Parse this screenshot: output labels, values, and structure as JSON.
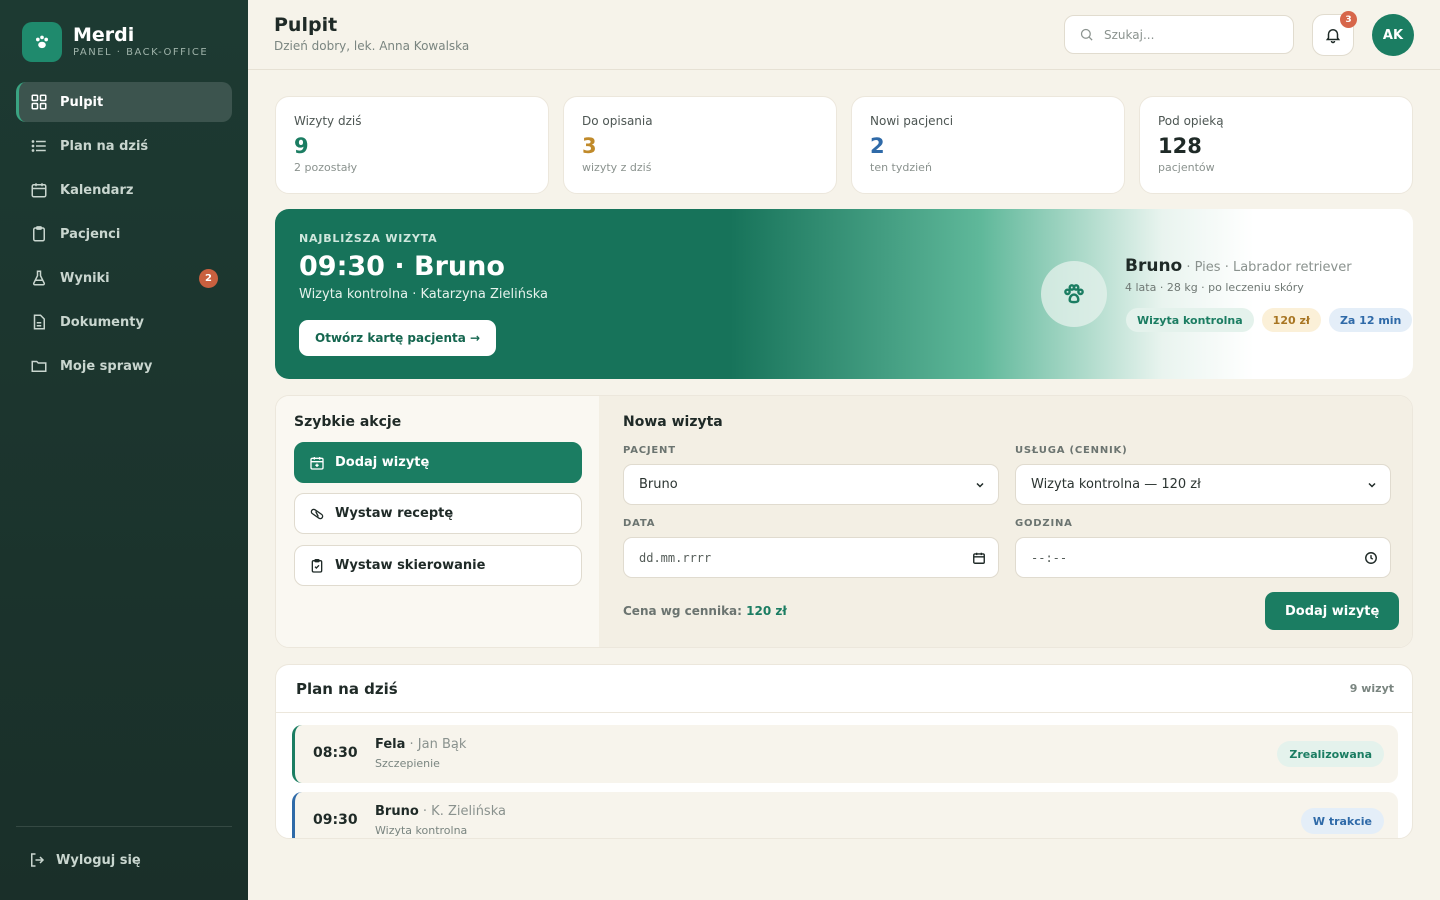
{
  "brand": {
    "name": "Merdi",
    "subtitle": "PANEL · BACK-OFFICE"
  },
  "sidebar": {
    "items": [
      {
        "label": "Pulpit",
        "icon": "grid-icon",
        "active": true
      },
      {
        "label": "Plan na dziś",
        "icon": "list-icon"
      },
      {
        "label": "Kalendarz",
        "icon": "calendar-icon"
      },
      {
        "label": "Pacjenci",
        "icon": "clipboard-icon"
      },
      {
        "label": "Wyniki",
        "icon": "flask-icon",
        "badge": "2"
      },
      {
        "label": "Dokumenty",
        "icon": "document-icon"
      },
      {
        "label": "Moje sprawy",
        "icon": "folder-icon"
      }
    ],
    "logout": "Wyloguj się"
  },
  "header": {
    "title": "Pulpit",
    "subtitle": "Dzień dobry, lek. Anna Kowalska",
    "search_placeholder": "Szukaj...",
    "notifications": "3",
    "avatar": "AK"
  },
  "stats": [
    {
      "label": "Wizyty dziś",
      "value": "9",
      "sub": "2 pozostały",
      "color": "#1b7d62"
    },
    {
      "label": "Do opisania",
      "value": "3",
      "sub": "wizyty z dziś",
      "color": "#c08a2a"
    },
    {
      "label": "Nowi pacjenci",
      "value": "2",
      "sub": "ten tydzień",
      "color": "#2f6aa8"
    },
    {
      "label": "Pod opieką",
      "value": "128",
      "sub": "pacjentów",
      "color": "#1f2a27"
    }
  ],
  "hero": {
    "kicker": "NAJBLIŻSZA WIZYTA",
    "title": "09:30 · Bruno",
    "subtitle": "Wizyta kontrolna · Katarzyna Zielińska",
    "button": "Otwórz kartę pacjenta →",
    "pet_name": "Bruno",
    "pet_breed": " · Pies · Labrador retriever",
    "pet_info": "4 lata · 28 kg · po leczeniu skóry",
    "chips": [
      "Wizyta kontrolna",
      "120 zł",
      "Za 12 min"
    ]
  },
  "quick_actions": {
    "title": "Szybkie akcje",
    "items": [
      "Dodaj wizytę",
      "Wystaw receptę",
      "Wystaw skierowanie"
    ]
  },
  "new_visit": {
    "title": "Nowa wizyta",
    "patient_label": "PACJENT",
    "patient_value": "Bruno",
    "service_label": "USŁUGA (CENNIK)",
    "service_value": "Wizyta kontrolna — 120 zł",
    "date_label": "DATA",
    "date_placeholder": "dd.mm.rrrr",
    "time_label": "GODZINA",
    "time_placeholder": "--:--",
    "price_prefix": "Cena wg cennika: ",
    "price_value": "120 zł",
    "submit": "Dodaj wizytę"
  },
  "plan": {
    "title": "Plan na dziś",
    "count": "9 wizyt",
    "rows": [
      {
        "time": "08:30",
        "pet": "Fela",
        "owner": " · Jan Bąk",
        "service": "Szczepienie",
        "status": "Zrealizowana",
        "accent": "#1b7d62"
      },
      {
        "time": "09:30",
        "pet": "Bruno",
        "owner": " · K. Zielińska",
        "service": "Wizyta kontrolna",
        "status": "W trakcie",
        "accent": "#2f6aa8"
      }
    ]
  }
}
